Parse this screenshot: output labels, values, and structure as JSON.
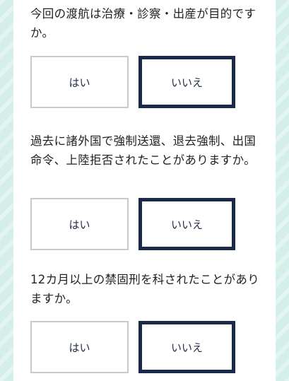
{
  "questions": [
    {
      "text": "今回の渡航は治療・診察・出産が目的ですか。",
      "yes_label": "はい",
      "no_label": "いいえ",
      "selected": "no"
    },
    {
      "text": "過去に諸外国で強制送還、退去強制、出国命令、上陸拒否されたことがありますか。",
      "yes_label": "はい",
      "no_label": "いいえ",
      "selected": "no"
    },
    {
      "text": "12カ月以上の禁固刑を科されたことがありますか。",
      "yes_label": "はい",
      "no_label": "いいえ",
      "selected": "no"
    }
  ],
  "colors": {
    "background": "#d4efe9",
    "card": "#ffffff",
    "selected_border": "#1b2a4a",
    "unselected_border": "#c9c9c9",
    "text": "#222222"
  }
}
